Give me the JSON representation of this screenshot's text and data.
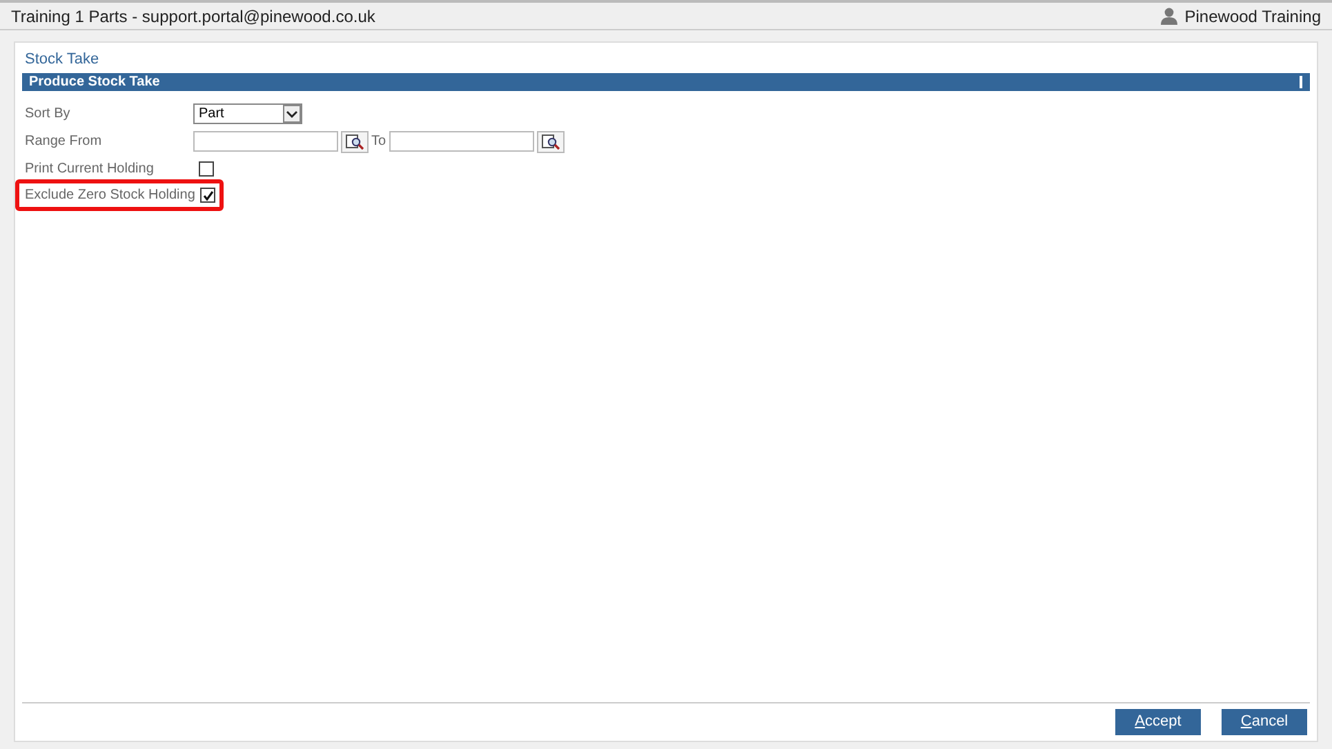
{
  "window": {
    "title": "Training 1 Parts - support.portal@pinewood.co.uk",
    "user": "Pinewood Training"
  },
  "page_title": "Stock Take",
  "section": {
    "title": "Produce Stock Take"
  },
  "form": {
    "sort_by": {
      "label": "Sort By",
      "value": "Part"
    },
    "range": {
      "label": "Range From",
      "to_label": "To"
    },
    "checks": [
      {
        "label": "Print Current Holding",
        "checked": false,
        "highlighted": false
      },
      {
        "label": "Exclude Zero Stock Holding",
        "checked": true,
        "highlighted": true
      }
    ]
  },
  "buttons": [
    "Accept",
    "Cancel"
  ]
}
